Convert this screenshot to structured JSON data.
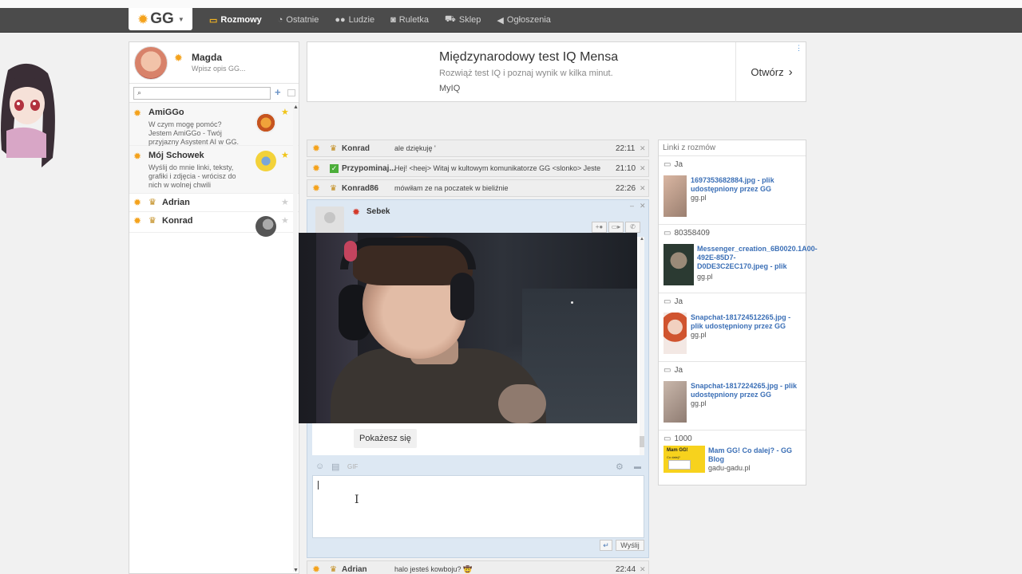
{
  "topbar": {
    "logo_text": "GG",
    "nav": [
      {
        "label": "Rozmowy",
        "icon": "chat-icon"
      },
      {
        "label": "Ostatnie",
        "icon": "clock-icon"
      },
      {
        "label": "Ludzie",
        "icon": "people-icon"
      },
      {
        "label": "Ruletka",
        "icon": "roulette-icon"
      },
      {
        "label": "Sklep",
        "icon": "cart-icon"
      },
      {
        "label": "Ogłoszenia",
        "icon": "megaphone-icon"
      }
    ]
  },
  "profile": {
    "name": "Magda",
    "description": "Wpisz opis GG..."
  },
  "contacts": [
    {
      "name": "AmiGGo",
      "description": "W czym mogę pomóc? Jestem AmiGGo - Twój przyjazny Asystent AI w GG."
    },
    {
      "name": "Mój Schowek",
      "description": "Wyślij do mnie linki, teksty, grafiki i zdjęcia - wrócisz do nich w wolnej chwili"
    },
    {
      "name": "Adrian",
      "description": ""
    },
    {
      "name": "Konrad",
      "description": ""
    }
  ],
  "ad": {
    "title": "Międzynarodowy test IQ Mensa",
    "subtitle": "Rozwiąż test IQ i poznaj wynik w kilka minut.",
    "source": "MyIQ",
    "open_label": "Otwórz"
  },
  "conversations": [
    {
      "name": "Konrad",
      "message": "ale dziękuję '",
      "time": "22:11"
    },
    {
      "name": "Przypominaj...",
      "message": "Hej! <heej> Witaj w kultowym komunikatorze GG <slonko> Jeste",
      "time": "21:10"
    },
    {
      "name": "Konrad86",
      "message": "mówiłam ze na poczatek w bieliźnie",
      "time": "22:26"
    }
  ],
  "bottom_conversation": {
    "name": "Adrian",
    "message": "halo jesteś kowboju? 🤠",
    "time": "22:44"
  },
  "chat": {
    "name": "Sebek",
    "message": "Pokażesz się",
    "gif_label": "GIF",
    "send_label": "Wyślij"
  },
  "links_panel": {
    "header": "Linki z rozmów",
    "items": [
      {
        "sender": "Ja",
        "title": "1697353682884.jpg - plik udostępniony przez GG",
        "domain": "gg.pl"
      },
      {
        "sender": "80358409",
        "title": "Messenger_creation_6B0020.1A00-492E-85D7-D0DE3C2EC170.jpeg - plik",
        "domain": "gg.pl"
      },
      {
        "sender": "Ja",
        "title": "Snapchat-181724512265.jpg - plik udostępniony przez GG",
        "domain": "gg.pl"
      },
      {
        "sender": "Ja",
        "title": "Snapchat-1817224265.jpg - plik udostępniony przez GG",
        "domain": "gg.pl"
      },
      {
        "sender": "1000",
        "title": "Mam GG! Co dalej? - GG Blog",
        "domain": "gadu-gadu.pl",
        "thumb_title": "Mam GG!",
        "thumb_sub": "Co dalej?"
      }
    ]
  },
  "colors": {
    "topbar": "#4b4b4b",
    "accent": "#f4a21c",
    "link": "#3b6fb6",
    "chat_bg": "#dde8f3"
  }
}
